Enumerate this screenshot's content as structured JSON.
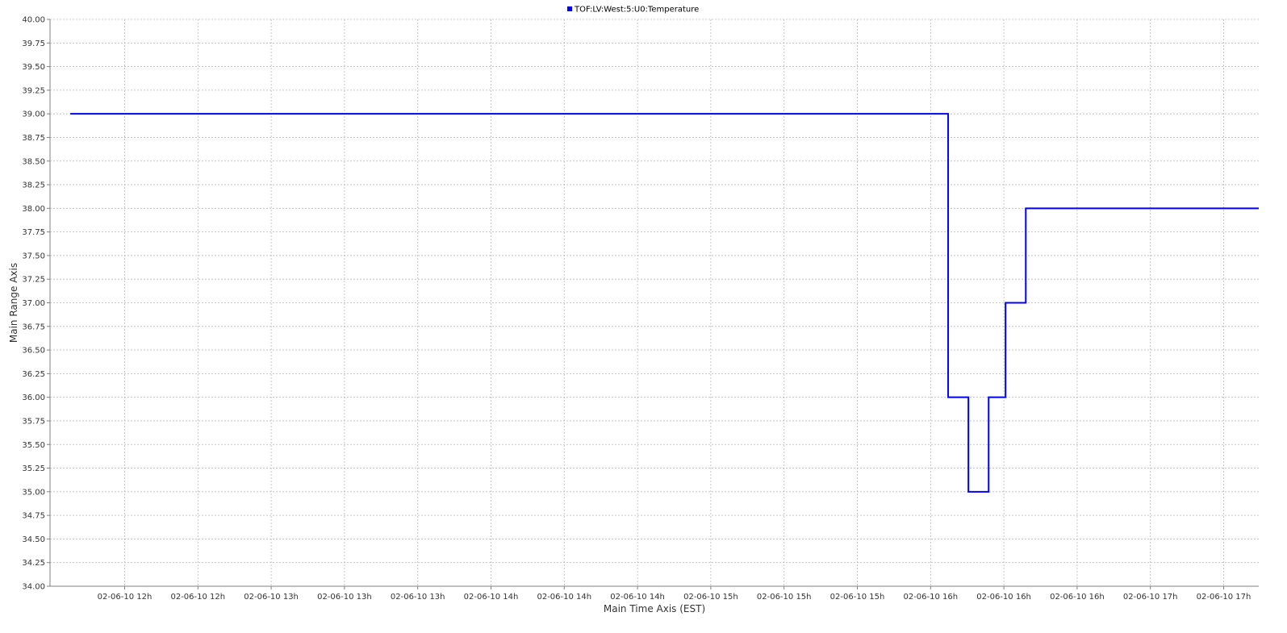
{
  "chart_data": {
    "type": "line",
    "legend": {
      "position": "top-center"
    },
    "grid": true,
    "xlabel": "Main Time Axis (EST)",
    "ylabel": "Main Range Axis",
    "ylim": [
      34.0,
      40.0
    ],
    "y_ticks": [
      "34.00",
      "34.25",
      "34.50",
      "34.75",
      "35.00",
      "35.25",
      "35.50",
      "35.75",
      "36.00",
      "36.25",
      "36.50",
      "36.75",
      "37.00",
      "37.25",
      "37.50",
      "37.75",
      "38.00",
      "38.25",
      "38.50",
      "38.75",
      "39.00",
      "39.25",
      "39.50",
      "39.75",
      "40.00"
    ],
    "x_ticks": [
      "02-06-10 12h",
      "02-06-10 12h",
      "02-06-10 13h",
      "02-06-10 13h",
      "02-06-10 13h",
      "02-06-10 14h",
      "02-06-10 14h",
      "02-06-10 14h",
      "02-06-10 15h",
      "02-06-10 15h",
      "02-06-10 15h",
      "02-06-10 16h",
      "02-06-10 16h",
      "02-06-10 16h",
      "02-06-10 17h",
      "02-06-10 17h"
    ],
    "xlim": [
      "2010-02-06 11:37",
      "2010-02-06 17:35"
    ],
    "series": [
      {
        "name": "TOF:LV:West:5:U0:Temperature",
        "color": "#0000ff",
        "step": true,
        "x": [
          "2010-02-06 11:43",
          "2010-02-06 16:03",
          "2010-02-06 16:09",
          "2010-02-06 16:15",
          "2010-02-06 16:20",
          "2010-02-06 16:26",
          "2010-02-06 17:35"
        ],
        "y": [
          39.0,
          36.0,
          35.0,
          36.0,
          37.0,
          38.0,
          38.0
        ]
      }
    ]
  }
}
